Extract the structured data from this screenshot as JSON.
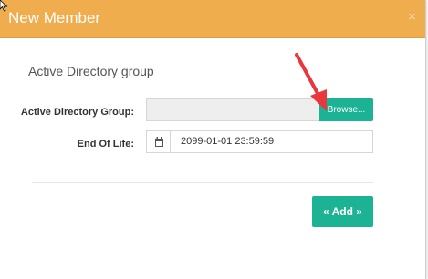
{
  "dialog": {
    "title": "New Member",
    "close_icon": "close-icon",
    "close_glyph": "×"
  },
  "section": {
    "title": "Active Directory group"
  },
  "fields": {
    "ad_group": {
      "label": "Active Directory Group:",
      "value": "",
      "browse_label": "Browse..."
    },
    "end_of_life": {
      "label": "End Of Life:",
      "value": "2099-01-01 23:59:59",
      "icon": "calendar-icon"
    }
  },
  "actions": {
    "add_label": "« Add »"
  },
  "colors": {
    "header": "#f0ad4e",
    "button": "#1bb394",
    "annotation_arrow": "#e8383d"
  }
}
